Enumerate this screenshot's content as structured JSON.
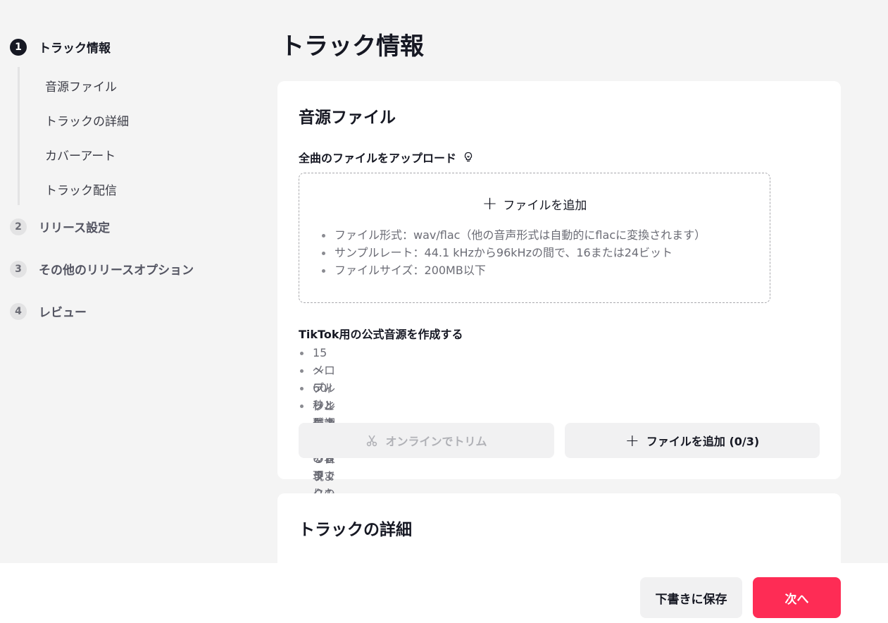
{
  "sidebar": {
    "steps": [
      {
        "number": "1",
        "label": "トラック情報"
      },
      {
        "number": "2",
        "label": "リリース設定"
      },
      {
        "number": "3",
        "label": "その他のリリースオプション"
      },
      {
        "number": "4",
        "label": "レビュー"
      }
    ],
    "substeps": [
      "音源ファイル",
      "トラックの詳細",
      "カバーアート",
      "トラック配信"
    ]
  },
  "main": {
    "page_title": "トラック情報",
    "audio_card": {
      "title": "音源ファイル",
      "upload_label": "全曲のファイルをアップロード",
      "add_file": "ファイルを追加",
      "requirements": [
        "ファイル形式：wav/flac（他の音声形式は自動的にflacに変換されます）",
        "サンプルレート：44.1 kHzから96kHzの間で、16または24ビット",
        "ファイルサイズ：200MB以下"
      ],
      "tiktok_label": "TikTok用の公式音源を作成する",
      "tiktok_points": [
        "15～60秒、最大3つの音まで",
        "メロディーと歌詞による表現",
        "フルレングスのトラックよりも短い",
        "フルレングスのトラックの一部である"
      ],
      "trim_button": "オンラインでトリム",
      "add_button": "ファイルを追加 (0/3)"
    },
    "details_card": {
      "title": "トラックの詳細"
    }
  },
  "footer": {
    "draft_button": "下書きに保存",
    "next_button": "次へ"
  },
  "colors": {
    "accent": "#fe2c55",
    "background": "#f4f4f4",
    "text": "#161823"
  }
}
